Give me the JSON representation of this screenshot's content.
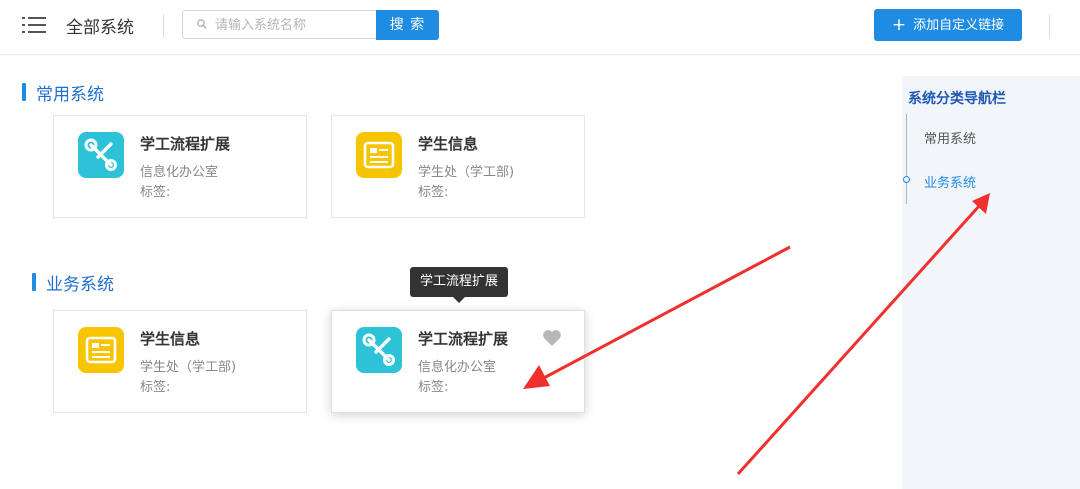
{
  "header": {
    "title": "全部系统",
    "search": {
      "placeholder": "请输入系统名称",
      "value": "",
      "button_label": "搜 索"
    },
    "add_button_label": "添加自定义链接",
    "add_button_icon": "plus-icon"
  },
  "sections": [
    {
      "title": "常用系统",
      "cards": [
        {
          "name": "学工流程扩展",
          "dept": "信息化办公室",
          "tag": "标签:",
          "icon": "tools-icon",
          "icon_color": "#2ec2d8"
        },
        {
          "name": "学生信息",
          "dept": "学生处（学工部)",
          "tag": "标签:",
          "icon": "id-card-icon",
          "icon_color": "#f7c500"
        }
      ]
    },
    {
      "title": "业务系统",
      "cards": [
        {
          "name": "学生信息",
          "dept": "学生处（学工部)",
          "tag": "标签:",
          "icon": "id-card-icon",
          "icon_color": "#f7c500"
        },
        {
          "name": "学工流程扩展",
          "dept": "信息化办公室",
          "tag": "标签:",
          "icon": "tools-icon",
          "icon_color": "#2ec2d8",
          "hovered": true
        }
      ]
    }
  ],
  "tooltip": {
    "text": "学工流程扩展"
  },
  "sidebar": {
    "title": "系统分类导航栏",
    "items": [
      {
        "label": "常用系统",
        "active": false
      },
      {
        "label": "业务系统",
        "active": true
      }
    ]
  },
  "annotations": {
    "arrow_color": "#f0302e",
    "arrow_count": 2
  },
  "colors": {
    "accent": "#1e8ce3",
    "section_title": "#1f6fd0",
    "sidebar_bg": "#f2f5f9"
  }
}
